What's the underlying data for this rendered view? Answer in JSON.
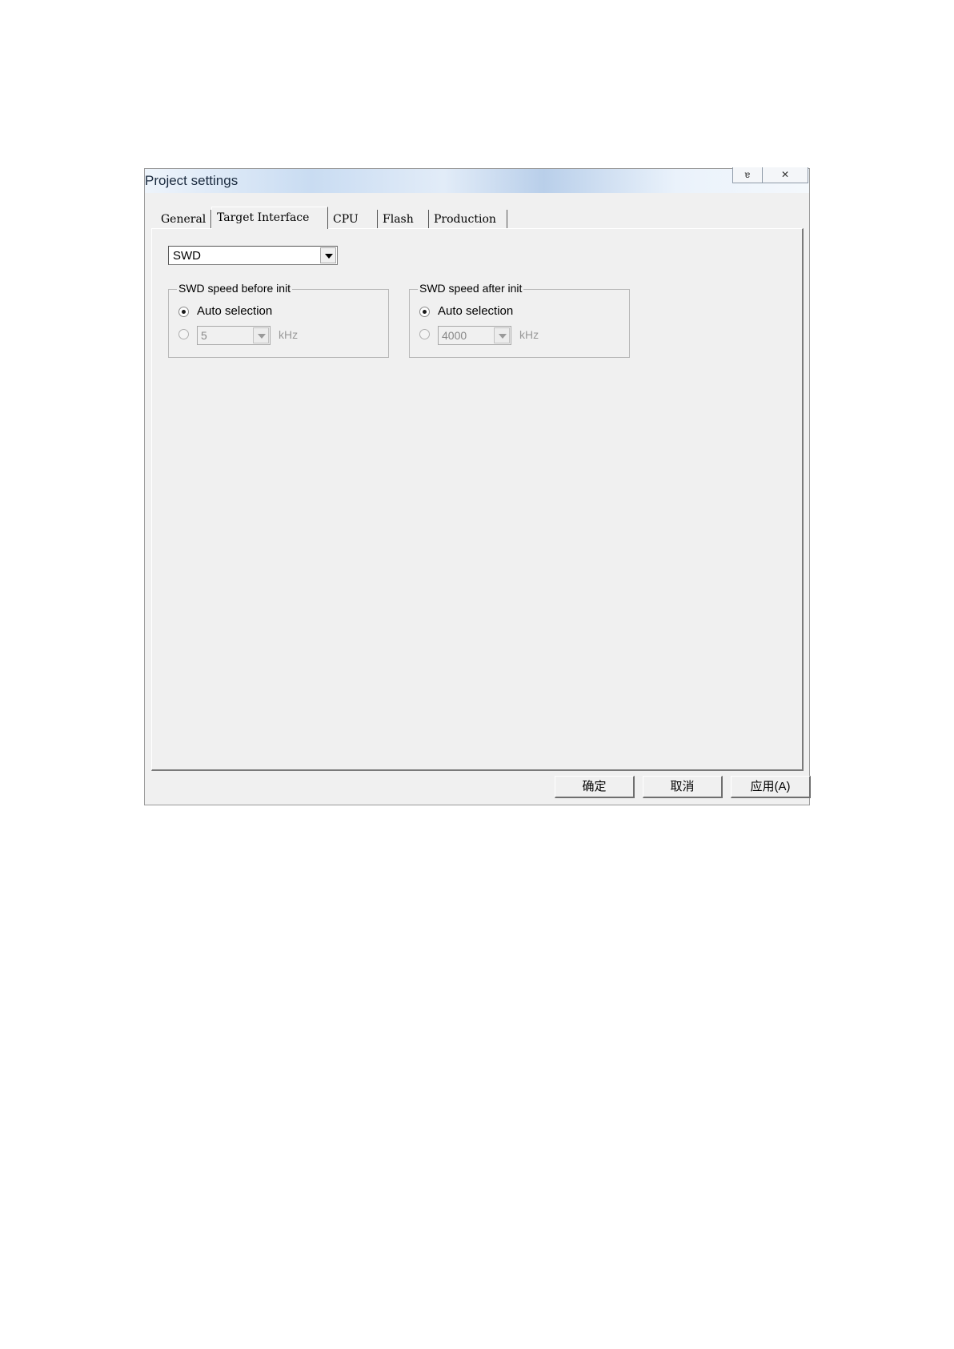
{
  "window": {
    "title": "Project settings",
    "help_icon": "help-icon",
    "close_icon": "close-icon"
  },
  "tabs": [
    {
      "label": "General"
    },
    {
      "label": "Target Interface"
    },
    {
      "label": "CPU"
    },
    {
      "label": "Flash"
    },
    {
      "label": "Production"
    }
  ],
  "interface": {
    "selected": "SWD"
  },
  "speed_before_init": {
    "title": "SWD speed before init",
    "auto_label": "Auto selection",
    "auto_checked": true,
    "manual_value": "5",
    "unit": "kHz"
  },
  "speed_after_init": {
    "title": "SWD speed after init",
    "auto_label": "Auto selection",
    "auto_checked": true,
    "manual_value": "4000",
    "unit": "kHz"
  },
  "buttons": {
    "ok": "确定",
    "cancel": "取消",
    "apply": "应用(A)"
  }
}
